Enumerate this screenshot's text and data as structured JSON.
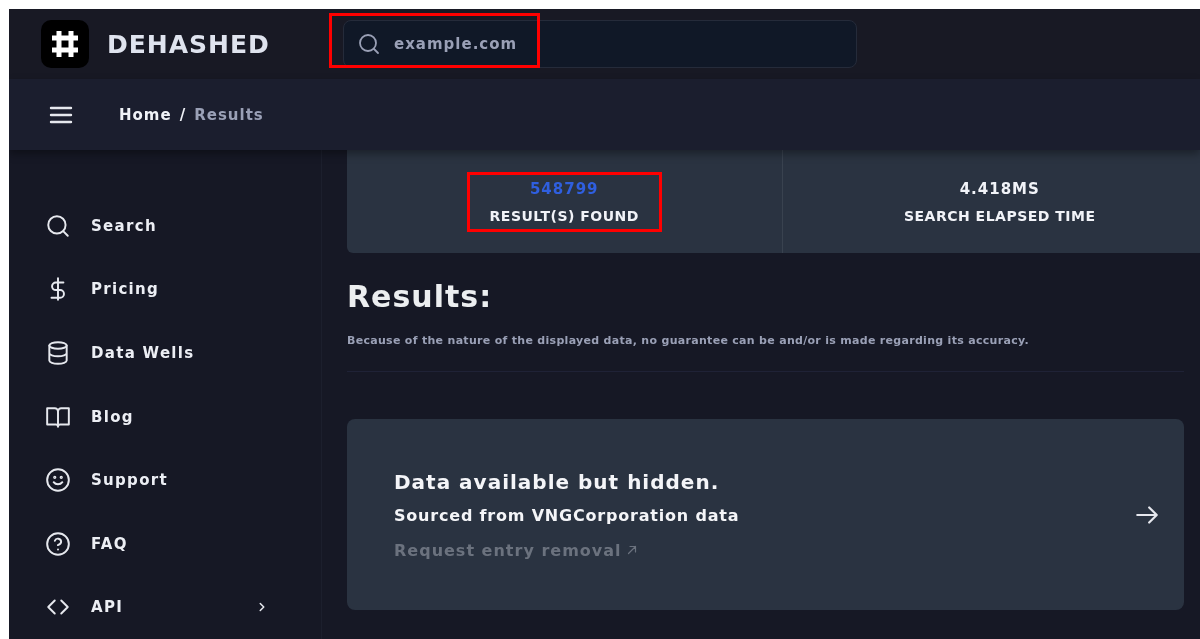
{
  "brand": {
    "name": "DEHASHED"
  },
  "search": {
    "placeholder": "example.com",
    "highlighted": true
  },
  "breadcrumb": {
    "separator": "/",
    "items": [
      {
        "label": "Home",
        "current": false
      },
      {
        "label": "Results",
        "current": true
      }
    ]
  },
  "sidebar": {
    "items": [
      {
        "label": "Search"
      },
      {
        "label": "Pricing"
      },
      {
        "label": "Data Wells"
      },
      {
        "label": "Blog"
      },
      {
        "label": "Support"
      },
      {
        "label": "FAQ"
      },
      {
        "label": "API",
        "expanded": false
      }
    ]
  },
  "stats": [
    {
      "kind": "count",
      "value": "548799",
      "label": "RESULT(S) FOUND",
      "highlighted": true
    },
    {
      "kind": "time",
      "value": "4.418MS",
      "label": "SEARCH ELAPSED TIME",
      "highlighted": false
    }
  ],
  "results": {
    "heading": "Results:",
    "disclaimer": "Because of the nature of the displayed data, no guarantee can be and/or is made regarding its accuracy.",
    "entries": [
      {
        "title": "Data available but hidden.",
        "source": "Sourced from VNGCorporation data",
        "link": "Request entry removal"
      }
    ]
  }
}
